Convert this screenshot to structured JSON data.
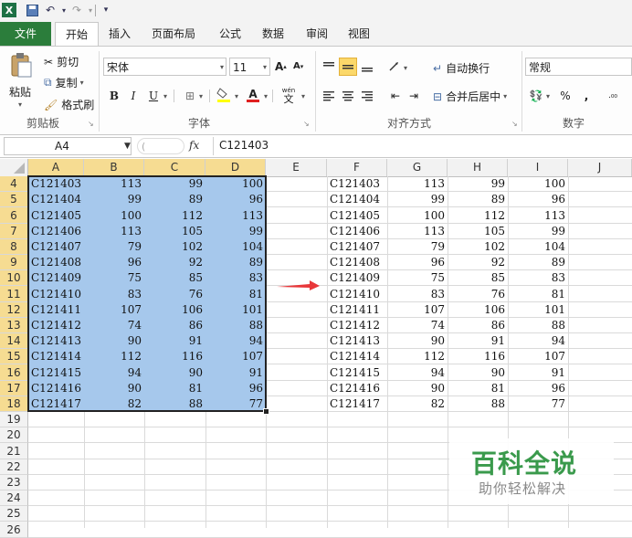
{
  "quick_access": {
    "dropdown_glyph": "▾"
  },
  "tabs": [
    {
      "label": "文件"
    },
    {
      "label": "开始"
    },
    {
      "label": "插入"
    },
    {
      "label": "页面布局"
    },
    {
      "label": "公式"
    },
    {
      "label": "数据"
    },
    {
      "label": "审阅"
    },
    {
      "label": "视图"
    }
  ],
  "ribbon": {
    "clipboard": {
      "paste": "粘贴",
      "cut": "剪切",
      "copy": "复制",
      "format_painter": "格式刷",
      "group": "剪贴板"
    },
    "font": {
      "name": "宋体",
      "size": "11",
      "grow": "A",
      "shrink": "A",
      "bold": "B",
      "italic": "I",
      "underline": "U",
      "phonetic": "wén",
      "group": "字体"
    },
    "alignment": {
      "wrap": "自动换行",
      "merge": "合并后居中",
      "group": "对齐方式"
    },
    "number": {
      "format": "常规",
      "percent": "%",
      "comma": ",",
      "group": "数字"
    }
  },
  "formula_bar": {
    "name_box": "A4",
    "fx": "fx",
    "formula": "C121403"
  },
  "columns": [
    "A",
    "B",
    "C",
    "D",
    "E",
    "F",
    "G",
    "H",
    "I",
    "J"
  ],
  "rows": [
    "4",
    "5",
    "6",
    "7",
    "8",
    "9",
    "10",
    "11",
    "12",
    "13",
    "14",
    "15",
    "16",
    "17",
    "18",
    "19",
    "20",
    "21",
    "22",
    "23",
    "24",
    "25",
    "26"
  ],
  "table": [
    [
      "C121403",
      "113",
      "99",
      "100"
    ],
    [
      "C121404",
      "99",
      "89",
      "96"
    ],
    [
      "C121405",
      "100",
      "112",
      "113"
    ],
    [
      "C121406",
      "113",
      "105",
      "99"
    ],
    [
      "C121407",
      "79",
      "102",
      "104"
    ],
    [
      "C121408",
      "96",
      "92",
      "89"
    ],
    [
      "C121409",
      "75",
      "85",
      "83"
    ],
    [
      "C121410",
      "83",
      "76",
      "81"
    ],
    [
      "C121411",
      "107",
      "106",
      "101"
    ],
    [
      "C121412",
      "74",
      "86",
      "88"
    ],
    [
      "C121413",
      "90",
      "91",
      "94"
    ],
    [
      "C121414",
      "112",
      "116",
      "107"
    ],
    [
      "C121415",
      "94",
      "90",
      "91"
    ],
    [
      "C121416",
      "90",
      "81",
      "96"
    ],
    [
      "C121417",
      "82",
      "88",
      "77"
    ]
  ],
  "watermark": {
    "title": "百科全说",
    "subtitle": "助你轻松解决"
  },
  "colors": {
    "selection": "#a6c8ec",
    "file_tab": "#2b7d3b",
    "arrow": "#e8373a",
    "watermark": "#3a9a4c"
  }
}
